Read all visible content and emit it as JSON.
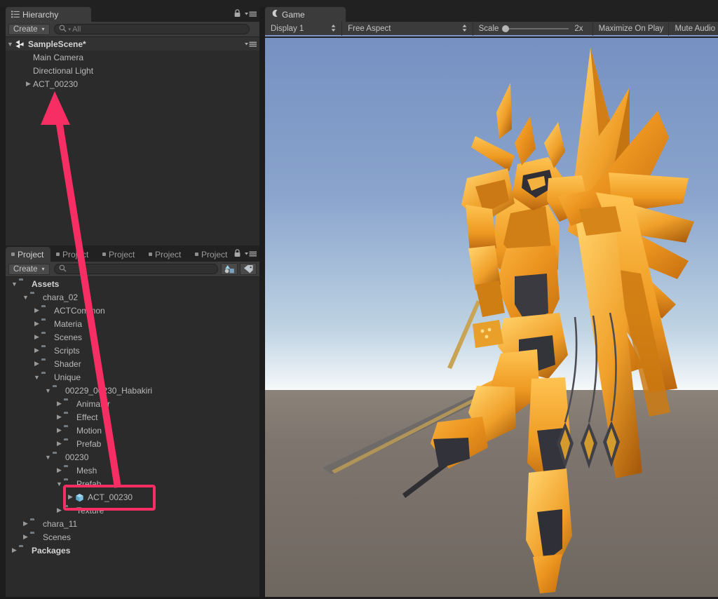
{
  "window": {
    "playbar": {
      "play_label": "",
      "pause_label": "",
      "step_label": ""
    }
  },
  "hierarchy": {
    "tab_label": "Hierarchy",
    "tab_icon": "hierarchy-icon",
    "create_label": "Create",
    "create_caret": "▾",
    "search_icon": "search-icon",
    "search_value": "",
    "search_placeholder": "All",
    "search_prefix": "Q▾",
    "lock_icon": "lock-icon",
    "menu_icon": "hamburger-menu-icon",
    "scene": {
      "name": "SampleScene*",
      "fold": "▼",
      "icon": "unity-scene-icon",
      "menu_icon": "hamburger-menu-icon"
    },
    "items": [
      {
        "label": "Main Camera",
        "fold": "",
        "depth": 1
      },
      {
        "label": "Directional Light",
        "fold": "",
        "depth": 1
      },
      {
        "label": "ACT_00230",
        "fold": "▶",
        "depth": 1
      }
    ]
  },
  "project": {
    "tabs": [
      {
        "label": "Project",
        "active": true
      },
      {
        "label": "Project",
        "active": false
      },
      {
        "label": "Project",
        "active": false
      },
      {
        "label": "Project",
        "active": false
      },
      {
        "label": "Project",
        "active": false
      }
    ],
    "lock_icon": "lock-icon",
    "menu_icon": "hamburger-menu-icon",
    "create_label": "Create",
    "create_caret": "▾",
    "search_icon": "search-icon",
    "search_value": "",
    "search_placeholder": "",
    "filter_type_icon": "filter-by-type-icon",
    "filter_label_icon": "filter-by-label-icon",
    "tree": [
      {
        "label": "Assets",
        "depth": 0,
        "fold": "▼",
        "icon": "folder-icon",
        "bold": true
      },
      {
        "label": "chara_02",
        "depth": 1,
        "fold": "▼",
        "icon": "folder-icon",
        "bold": false
      },
      {
        "label": "ACTCommon",
        "depth": 2,
        "fold": "▶",
        "icon": "folder-icon",
        "bold": false
      },
      {
        "label": "Materia",
        "depth": 2,
        "fold": "▶",
        "icon": "folder-icon",
        "bold": false
      },
      {
        "label": "Scenes",
        "depth": 2,
        "fold": "▶",
        "icon": "folder-icon",
        "bold": false
      },
      {
        "label": "Scripts",
        "depth": 2,
        "fold": "▶",
        "icon": "folder-icon",
        "bold": false
      },
      {
        "label": "Shader",
        "depth": 2,
        "fold": "▶",
        "icon": "folder-icon",
        "bold": false
      },
      {
        "label": "Unique",
        "depth": 2,
        "fold": "▼",
        "icon": "folder-icon",
        "bold": false
      },
      {
        "label": "00229_00230_Habakiri",
        "depth": 3,
        "fold": "▼",
        "icon": "folder-icon",
        "bold": false
      },
      {
        "label": "Animator",
        "depth": 4,
        "fold": "▶",
        "icon": "folder-icon",
        "bold": false
      },
      {
        "label": "Effect",
        "depth": 4,
        "fold": "▶",
        "icon": "folder-icon",
        "bold": false
      },
      {
        "label": "Motion",
        "depth": 4,
        "fold": "▶",
        "icon": "folder-icon",
        "bold": false
      },
      {
        "label": "Prefab",
        "depth": 4,
        "fold": "▶",
        "icon": "folder-icon",
        "bold": false
      },
      {
        "label": "00230",
        "depth": 3,
        "fold": "▼",
        "icon": "folder-icon",
        "bold": false
      },
      {
        "label": "Mesh",
        "depth": 4,
        "fold": "▶",
        "icon": "folder-icon",
        "bold": false
      },
      {
        "label": "Prefab",
        "depth": 4,
        "fold": "▼",
        "icon": "folder-icon",
        "bold": false
      },
      {
        "label": "ACT_00230",
        "depth": 5,
        "fold": "▶",
        "icon": "prefab-cube-icon",
        "bold": false
      },
      {
        "label": "Texture",
        "depth": 4,
        "fold": "▶",
        "icon": "folder-icon",
        "bold": false
      },
      {
        "label": "chara_11",
        "depth": 1,
        "fold": "▶",
        "icon": "folder-icon",
        "bold": false
      },
      {
        "label": "Scenes",
        "depth": 1,
        "fold": "▶",
        "icon": "folder-icon",
        "bold": false
      },
      {
        "label": "Packages",
        "depth": 0,
        "fold": "▶",
        "icon": "folder-icon",
        "bold": true
      }
    ]
  },
  "game": {
    "tab_label": "Game",
    "tab_icon": "game-view-icon",
    "display_label": "Display 1",
    "aspect_label": "Free Aspect",
    "scale_label": "Scale",
    "scale_value": "2x",
    "maximize_label": "Maximize On Play",
    "mute_label": "Mute Audio",
    "stepper_glyph": "↕",
    "render": {
      "description": "golden-orange winged mecha knight character with long sword and hanging chains",
      "sky_top_color": "#7691c2",
      "horizon_color": "#eef4f7",
      "ground_color": "#7d7570",
      "character_color": "#e8961f"
    }
  },
  "annotation": {
    "arrow_color": "#f72e63",
    "highlight_color": "#f72e63",
    "arrow_label": "annotation-arrow",
    "highlight_label": "annotation-highlight-box",
    "target_item": "ACT_00230"
  }
}
